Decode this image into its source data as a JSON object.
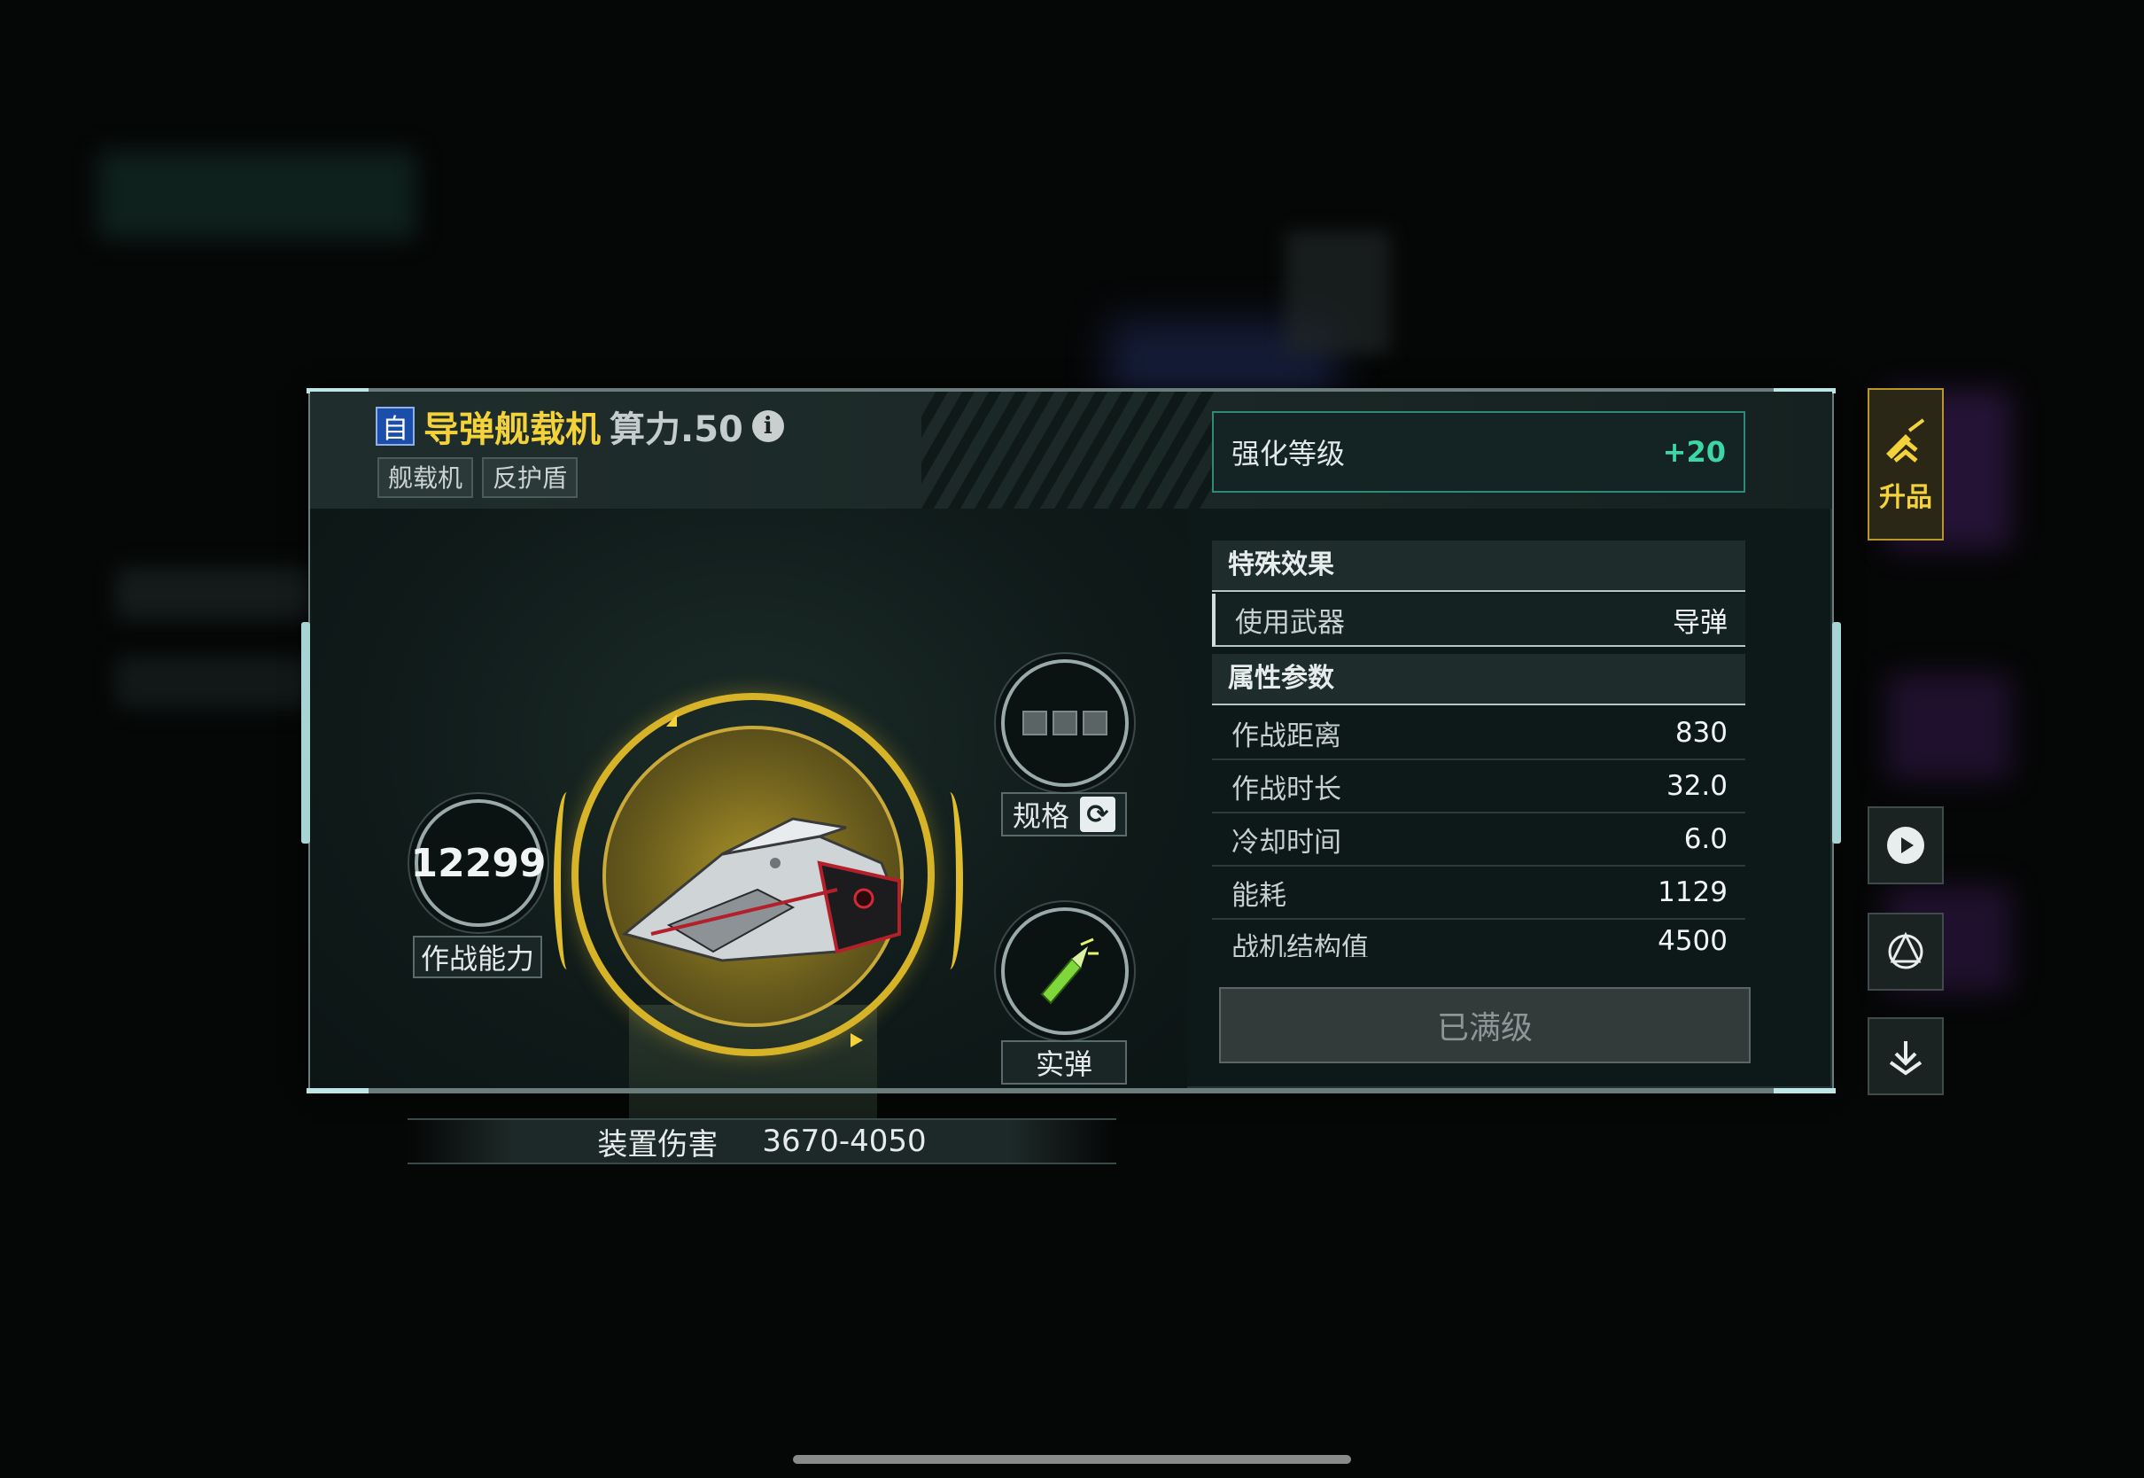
{
  "item": {
    "self_badge": "自",
    "title": "导弹舰载机",
    "power_rating": "算力.50",
    "info_icon": "info-icon",
    "tags": [
      "舰载机",
      "反护盾"
    ]
  },
  "enhance": {
    "label": "强化等级",
    "value": "+20"
  },
  "showcase": {
    "combat_power_value": "12299",
    "combat_power_label": "作战能力",
    "spec_label": "规格",
    "ammo_label": "实弹",
    "damage_label": "装置伤害",
    "damage_value": "3670-4050"
  },
  "special_effects": {
    "title": "特殊效果",
    "weapon_key": "使用武器",
    "weapon_value": "导弹"
  },
  "attributes": {
    "title": "属性参数",
    "rows": [
      {
        "key": "作战距离",
        "value": "830"
      },
      {
        "key": "作战时长",
        "value": "32.0"
      },
      {
        "key": "冷却时间",
        "value": "6.0"
      },
      {
        "key": "能耗",
        "value": "1129"
      },
      {
        "key": "战机结构值",
        "value": "4500"
      }
    ]
  },
  "action": {
    "max_level_label": "已满级"
  },
  "side_buttons": {
    "upgrade_label": "升品",
    "icons": [
      "upgrade-icon",
      "play-icon",
      "faction-icon",
      "download-icon"
    ]
  },
  "colors": {
    "accent_gold": "#f3d23a",
    "accent_green": "#3dd6a5",
    "panel_bg": "#0d1918"
  }
}
